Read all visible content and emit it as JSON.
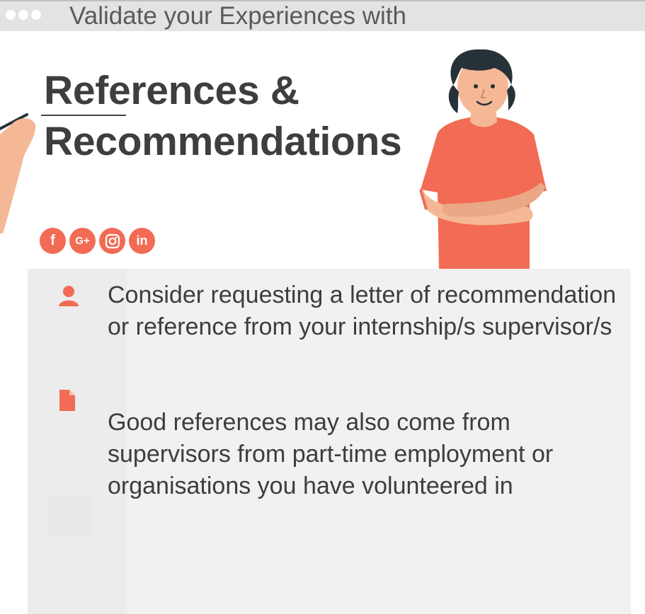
{
  "window": {
    "title": "Validate your Experiences with"
  },
  "header": {
    "heading_line1": "References &",
    "heading_line2": "Recommendations"
  },
  "social": {
    "items": [
      {
        "label": "f",
        "icon": "facebook-icon"
      },
      {
        "label": "G+",
        "icon": "google-plus-icon"
      },
      {
        "label": "◎",
        "icon": "instagram-icon"
      },
      {
        "label": "in",
        "icon": "linkedin-icon"
      }
    ]
  },
  "content": {
    "bullet1": "Consider requesting a letter of recommendation or reference from your internship/s supervisor/s",
    "bullet2": "Good references may also come from supervisors from part-time employment or organisations you have volunteered in"
  },
  "colors": {
    "accent": "#f26b54",
    "panel": "#f1f1f1",
    "text": "#3d3d3d"
  }
}
